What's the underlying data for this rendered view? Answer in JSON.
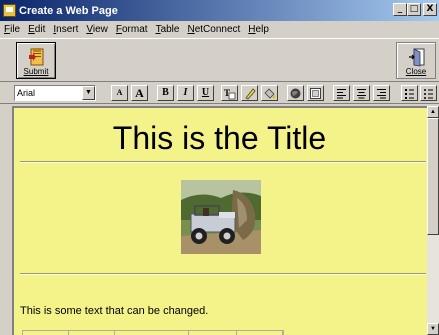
{
  "window": {
    "title": "Create a Web Page",
    "controls": [
      "_",
      "□",
      "X"
    ]
  },
  "menu": [
    "File",
    "Edit",
    "Insert",
    "View",
    "Format",
    "Table",
    "NetConnect",
    "Help"
  ],
  "toolbar": {
    "submit_label": "Submit",
    "close_label": "Close"
  },
  "format_bar": {
    "font": "Arial",
    "buttons": [
      {
        "name": "decrease-font-size-button",
        "glyph": "A",
        "icon": "decrease-font-icon"
      },
      {
        "name": "increase-font-size-button",
        "glyph": "A",
        "icon": "increase-font-icon"
      },
      {
        "name": "bold-button",
        "glyph": "B",
        "icon": "bold-icon"
      },
      {
        "name": "italic-button",
        "glyph": "I",
        "icon": "italic-icon"
      },
      {
        "name": "underline-button",
        "glyph": "U",
        "icon": "underline-icon"
      },
      {
        "name": "text-color-button",
        "glyph": "",
        "icon": "text-color-icon"
      },
      {
        "name": "highlight-button",
        "glyph": "",
        "icon": "highlighter-icon"
      },
      {
        "name": "fill-color-button",
        "glyph": "",
        "icon": "paint-bucket-icon"
      },
      {
        "name": "insert-link-button",
        "glyph": "",
        "icon": "globe-icon"
      },
      {
        "name": "insert-image-button",
        "glyph": "",
        "icon": "image-icon"
      },
      {
        "name": "align-left-button",
        "glyph": "",
        "icon": "align-left-icon"
      },
      {
        "name": "align-center-button",
        "glyph": "",
        "icon": "align-center-icon"
      },
      {
        "name": "align-right-button",
        "glyph": "",
        "icon": "align-right-icon"
      },
      {
        "name": "numbered-list-button",
        "glyph": "",
        "icon": "numbered-list-icon"
      },
      {
        "name": "bulleted-list-button",
        "glyph": "",
        "icon": "bulleted-list-icon"
      }
    ]
  },
  "document": {
    "title": "This is the Title",
    "image_alt": "jeep",
    "body_text": "This is some text that can be changed.",
    "background": "#f3f38a"
  }
}
